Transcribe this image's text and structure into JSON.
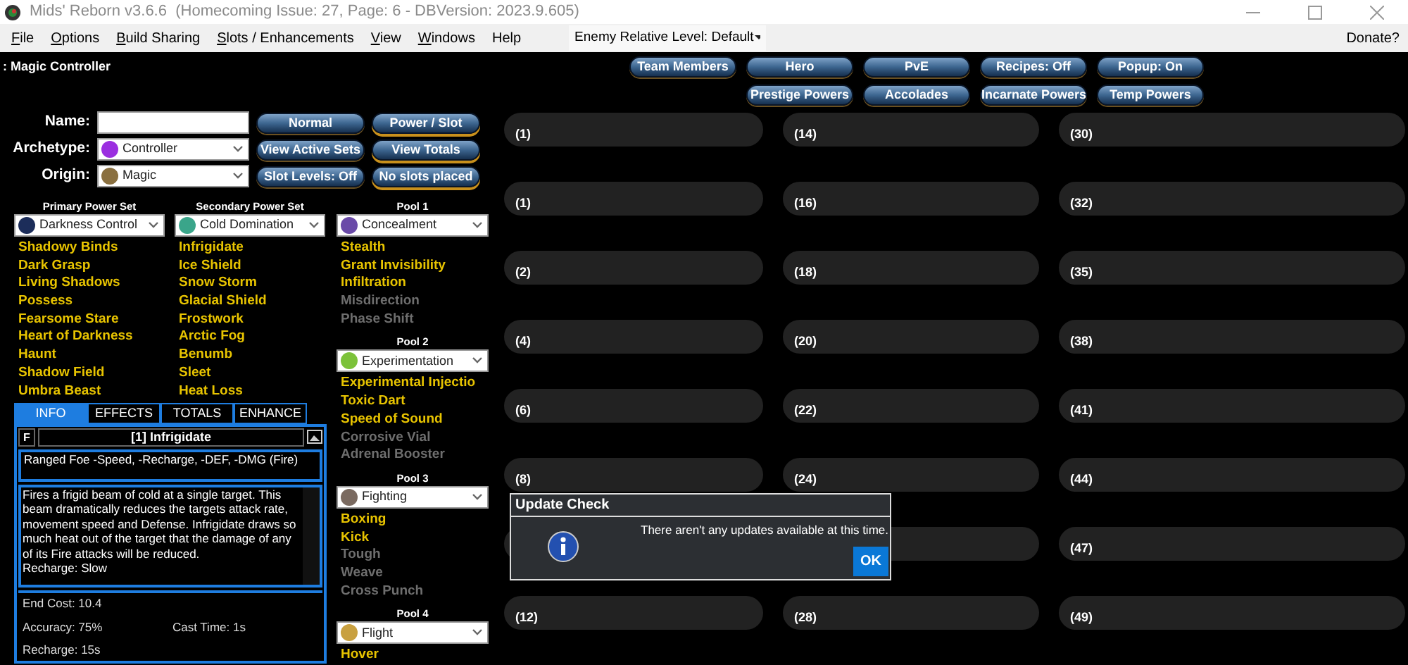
{
  "window": {
    "title": "Mids' Reborn v3.6.6  (Homecoming Issue: 27, Page: 6 - DBVersion: 2023.9.605)"
  },
  "menu": [
    {
      "label": "File",
      "access_key": true
    },
    {
      "label": "Options",
      "access_key": true
    },
    {
      "label": "Build Sharing",
      "access_key": true
    },
    {
      "label": "Slots / Enhancements",
      "access_key": true
    },
    {
      "label": "View",
      "access_key": true
    },
    {
      "label": "Windows",
      "access_key": true
    },
    {
      "label": "Help",
      "access_key": false
    }
  ],
  "enemy_level": {
    "value": "Enemy Relative Level: Default"
  },
  "donate": "Donate?",
  "build_title": ": Magic Controller",
  "top_buttons": [
    [
      "Team Members",
      "Hero",
      "PvE",
      "Recipes: Off",
      "Popup: On"
    ],
    [
      "Prestige Powers",
      "Accolades",
      "Incarnate Powers",
      "Temp Powers"
    ]
  ],
  "fields": [
    {
      "kind": "text",
      "label": "Name:"
    },
    {
      "kind": "select",
      "label": "Archetype:",
      "value": "Controller",
      "color": "#9b2fe0"
    },
    {
      "kind": "select",
      "label": "Origin:",
      "value": "Magic",
      "color": "#8a7040"
    }
  ],
  "side_buttons": [
    [
      "Normal",
      "Power / Slot"
    ],
    [
      "View Active Sets",
      "View Totals"
    ],
    [
      "Slot Levels: Off",
      "No slots placed"
    ]
  ],
  "power_sets": [
    {
      "kind": "main",
      "header": "Primary Power Set",
      "value": "Darkness Control",
      "color": "#1c2d5a",
      "powers": [
        {
          "name": "Shadowy Binds",
          "available": true
        },
        {
          "name": "Dark Grasp",
          "available": true
        },
        {
          "name": "Living Shadows",
          "available": true
        },
        {
          "name": "Possess",
          "available": true
        },
        {
          "name": "Fearsome Stare",
          "available": true
        },
        {
          "name": "Heart of Darkness",
          "available": true
        },
        {
          "name": "Haunt",
          "available": true
        },
        {
          "name": "Shadow Field",
          "available": true
        },
        {
          "name": "Umbra Beast",
          "available": true
        }
      ]
    },
    {
      "kind": "main",
      "header": "Secondary Power Set",
      "value": "Cold Domination",
      "color": "#3aa58a",
      "powers": [
        {
          "name": "Infrigidate",
          "available": true
        },
        {
          "name": "Ice Shield",
          "available": true
        },
        {
          "name": "Snow Storm",
          "available": true
        },
        {
          "name": "Glacial Shield",
          "available": true
        },
        {
          "name": "Frostwork",
          "available": true
        },
        {
          "name": "Arctic Fog",
          "available": true
        },
        {
          "name": "Benumb",
          "available": true
        },
        {
          "name": "Sleet",
          "available": true
        },
        {
          "name": "Heat Loss",
          "available": true
        }
      ]
    },
    {
      "kind": "pool",
      "header": "Pool 1",
      "value": "Concealment",
      "color": "#6a4aa8",
      "powers": [
        {
          "name": "Stealth",
          "available": true
        },
        {
          "name": "Grant Invisibility",
          "available": true
        },
        {
          "name": "Infiltration",
          "available": true
        },
        {
          "name": "Misdirection",
          "available": false
        },
        {
          "name": "Phase Shift",
          "available": false
        }
      ]
    },
    {
      "kind": "pool",
      "header": "Pool 2",
      "value": "Experimentation",
      "color": "#7cc23a",
      "powers": [
        {
          "name": "Experimental Injectio",
          "available": true
        },
        {
          "name": "Toxic Dart",
          "available": true
        },
        {
          "name": "Speed of Sound",
          "available": true
        },
        {
          "name": "Corrosive Vial",
          "available": false
        },
        {
          "name": "Adrenal Booster",
          "available": false
        }
      ]
    },
    {
      "kind": "pool",
      "header": "Pool 3",
      "value": "Fighting",
      "color": "#7a6a60",
      "powers": [
        {
          "name": "Boxing",
          "available": true
        },
        {
          "name": "Kick",
          "available": true
        },
        {
          "name": "Tough",
          "available": false
        },
        {
          "name": "Weave",
          "available": false
        },
        {
          "name": "Cross Punch",
          "available": false
        }
      ]
    },
    {
      "kind": "pool",
      "header": "Pool 4",
      "value": "Flight",
      "color": "#c8a040",
      "powers": [
        {
          "name": "Hover",
          "available": true
        }
      ]
    }
  ],
  "info_tabs": [
    {
      "label": "INFO",
      "selected": true
    },
    {
      "label": "EFFECTS",
      "selected": false
    },
    {
      "label": "TOTALS",
      "selected": false
    },
    {
      "label": "ENHANCE",
      "selected": false
    }
  ],
  "info": {
    "flag": "F",
    "title": "[1] Infrigidate",
    "short": "Ranged Foe -Speed, -Recharge, -DEF, -DMG (Fire)",
    "long": "Fires a frigid beam of cold at a single target. This beam dramatically reduces the targets attack rate, movement speed and Defense. Infrigidate draws so much heat out of the target that the damage of any of its Fire attacks will be reduced.\nRecharge: Slow",
    "stats": [
      [
        "End Cost: 10.4"
      ],
      [
        "Accuracy: 75%",
        "Cast Time: 1s"
      ],
      [
        "Recharge: 15s"
      ]
    ]
  },
  "slot_columns": [
    [
      {
        "label": "(1)"
      },
      {
        "label": "(1)"
      },
      {
        "label": "(2)"
      },
      {
        "label": "(4)"
      },
      {
        "label": "(6)"
      },
      {
        "label": "(8)"
      },
      {},
      {
        "label": "(12)"
      }
    ],
    [
      {
        "label": "(14)"
      },
      {
        "label": "(16)"
      },
      {
        "label": "(18)"
      },
      {
        "label": "(20)"
      },
      {
        "label": "(22)"
      },
      {
        "label": "(24)"
      },
      {},
      {
        "label": "(28)"
      }
    ],
    [
      {
        "label": "(30)"
      },
      {
        "label": "(32)"
      },
      {
        "label": "(35)"
      },
      {
        "label": "(38)"
      },
      {
        "label": "(41)"
      },
      {
        "label": "(44)"
      },
      {
        "label": "(47)"
      },
      {
        "label": "(49)"
      }
    ]
  ],
  "dialog": {
    "title": "Update Check",
    "message": "There aren't any updates available at this time.",
    "button": "OK"
  }
}
